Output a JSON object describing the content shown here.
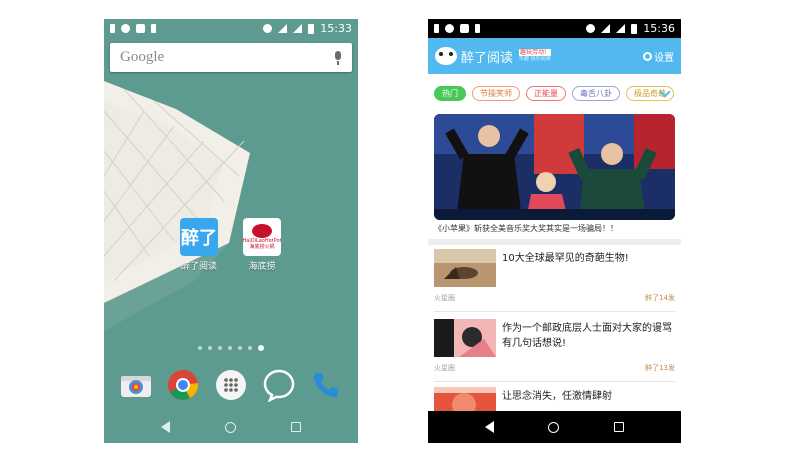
{
  "colors": {
    "launcher_wallpaper": "#5d9a90",
    "app_header": "#52b9f0",
    "hot_tag": "#47c857",
    "statusbar_dark": "#000000"
  },
  "home": {
    "status_time": "15:33",
    "search_placeholder": "Google",
    "apps": [
      {
        "label": "醉了阅读",
        "tile_text": "醉了",
        "icon": "zuile-read-app-icon"
      },
      {
        "label": "海底捞",
        "tile_text": "HaiDiLaoHotPot",
        "tile_sub": "海底捞火锅",
        "icon": "haidilao-app-icon"
      }
    ],
    "page_count": 7,
    "active_page": 7,
    "dock": [
      "camera-icon",
      "chrome-icon",
      "app-drawer-icon",
      "messages-icon",
      "phone-icon"
    ]
  },
  "app": {
    "status_time": "15:36",
    "brand_name": "醉了阅读",
    "brand_tagline": "趣玩劳动!",
    "brand_tagline_sub": "乐趣 快乐阅读",
    "settings_label": "设置",
    "tags": [
      "热门",
      "节操笑师",
      "正能量",
      "毒舌八卦",
      "极品奇葩"
    ],
    "hero_caption": "《小苹果》斩获全美音乐奖大奖其实是一场骗局！！",
    "articles": [
      {
        "title": "10大全球最罕见的奇葩生物!",
        "source": "火星圈",
        "count": "醉了14发"
      },
      {
        "title": "作为一个邮政底层人士面对大家的谩骂有几句话想说!",
        "source": "火星圈",
        "count": "醉了13发"
      },
      {
        "title": "让思念消失，任激情肆射",
        "source": "",
        "count": ""
      }
    ]
  }
}
